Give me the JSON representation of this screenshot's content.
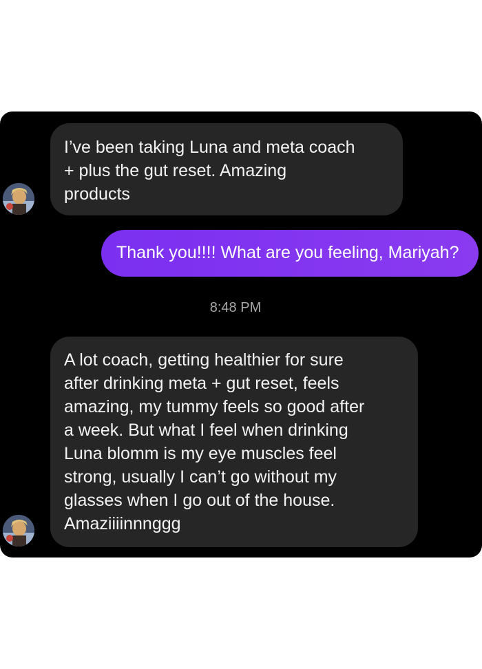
{
  "conversation": {
    "messages": [
      {
        "direction": "incoming",
        "text": "I’ve been taking Luna and meta coach\n+ plus the gut reset. Amazing\nproducts"
      },
      {
        "direction": "outgoing",
        "text": "Thank you!!!! What are you feeling, Mariyah?"
      },
      {
        "direction": "incoming",
        "text": "A lot coach, getting healthier for sure\nafter drinking meta + gut reset, feels\namazing, my tummy feels so good after\na week. But what I feel when drinking\nLuna blomm is my eye muscles feel\nstrong, usually I can’t go without my\nglasses when I go out of the house.\nAmaziiiinnnggg"
      }
    ],
    "timestamp": "8:48 PM"
  },
  "colors": {
    "panel_background": "#000000",
    "incoming_bubble": "#262626",
    "outgoing_bubble": "#7b2ff0",
    "timestamp_text": "#a8a8a8"
  },
  "icons": {
    "avatar": "profile-photo"
  }
}
